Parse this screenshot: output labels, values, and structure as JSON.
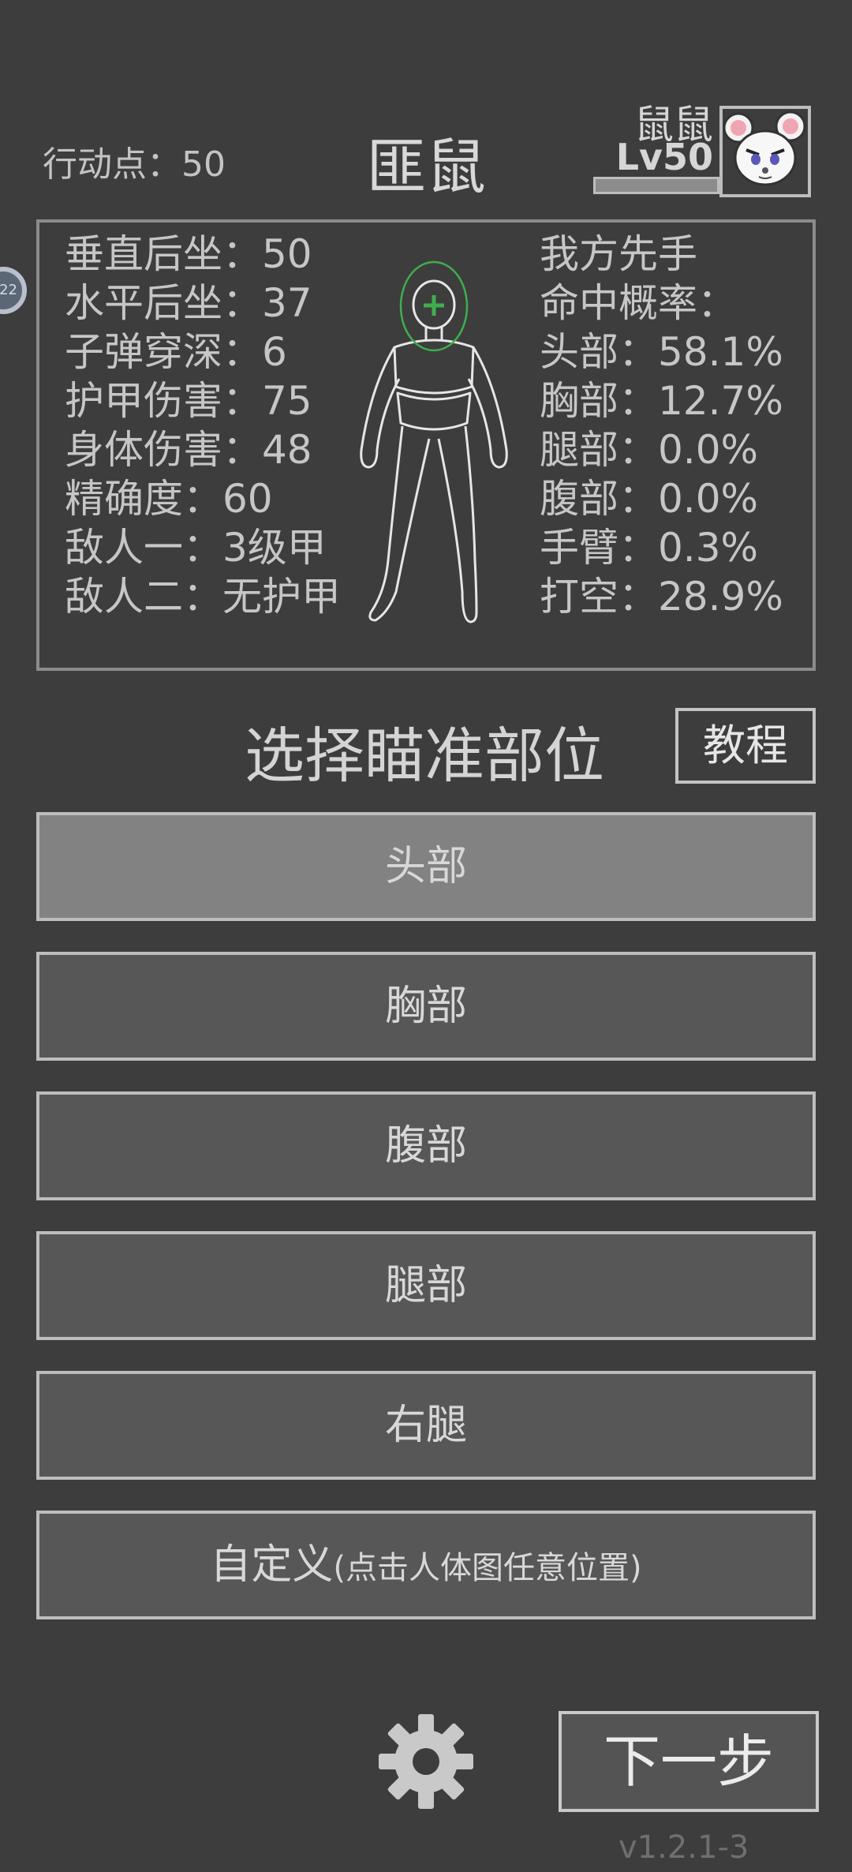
{
  "header": {
    "action_points": "行动点：50",
    "title": "匪鼠",
    "player_name": "鼠鼠",
    "player_level": "Lv50",
    "xp_fraction": 1.0
  },
  "side_chip": "22",
  "stats": {
    "left": [
      "垂直后坐：50",
      "水平后坐：37",
      "子弹穿深：6",
      "护甲伤害：75",
      "身体伤害：48",
      "精确度：60",
      "敌人一：3级甲",
      "敌人二：无护甲"
    ],
    "right": [
      "我方先手",
      "命中概率：",
      "头部：58.1%",
      "胸部：12.7%",
      "腿部：0.0%",
      "腹部：0.0%",
      "手臂：0.3%",
      "打空：28.9%"
    ]
  },
  "aim": {
    "title": "选择瞄准部位",
    "tutorial_label": "教程"
  },
  "targets": [
    {
      "label": "头部",
      "selected": true
    },
    {
      "label": "胸部",
      "selected": false
    },
    {
      "label": "腹部",
      "selected": false
    },
    {
      "label": "腿部",
      "selected": false
    },
    {
      "label": "右腿",
      "selected": false
    }
  ],
  "custom": {
    "label": "自定义",
    "hint": "(点击人体图任意位置)"
  },
  "footer": {
    "next_label": "下一步",
    "version": "v1.2.1-3"
  },
  "icons": {
    "settings": "gear-icon",
    "avatar": "mouse-avatar-icon",
    "crosshair": "crosshair-icon"
  },
  "colors": {
    "background": "#3d3d3d",
    "button": "#575757",
    "button_selected": "#828282",
    "reticle": "#3fae4e"
  }
}
